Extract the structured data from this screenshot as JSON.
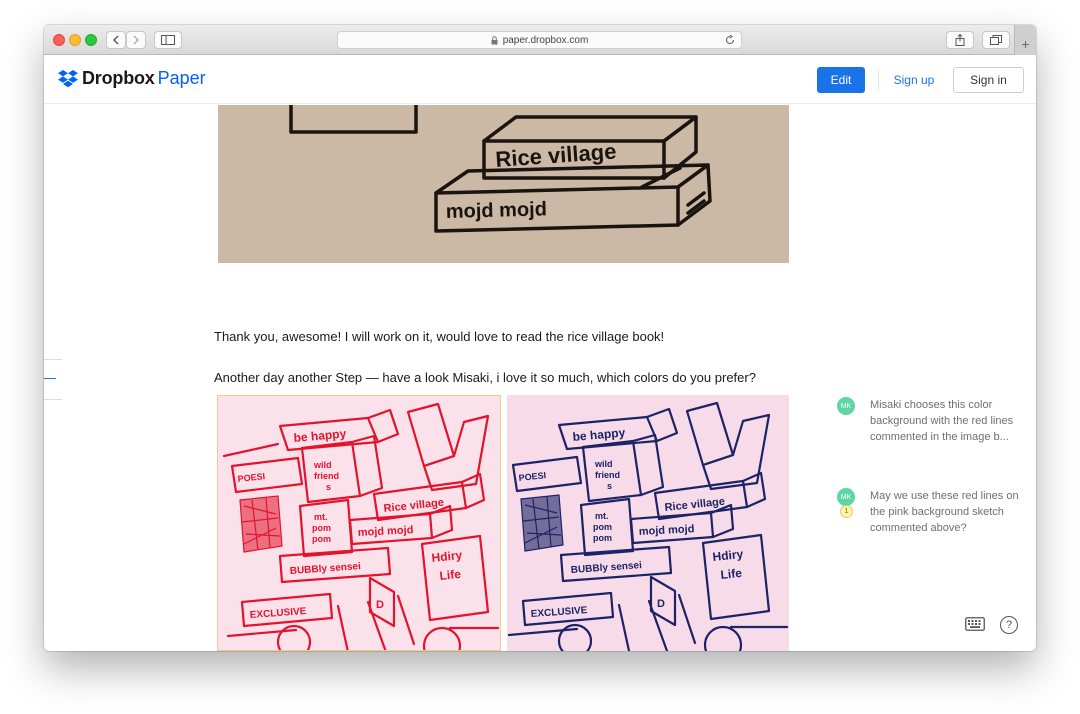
{
  "browser": {
    "url": "paper.dropbox.com",
    "new_tab_label": "+"
  },
  "header": {
    "brand_word": "Dropbox",
    "brand_product": "Paper",
    "edit_label": "Edit",
    "signup_label": "Sign up",
    "signin_label": "Sign in"
  },
  "doc": {
    "paragraph_1": "Thank you, awesome! I will work on it, would love to read the rice village book!",
    "paragraph_2": "Another day another Step — have a look Misaki, i love it so much, which colors do you prefer?",
    "sketch_top": {
      "book_1": "Rice village",
      "book_2": "mojd mojd"
    },
    "sketch_books": {
      "be_happy": "be happy",
      "poesi": "POESI",
      "wild": "wild",
      "friends": "friend",
      "s": "s",
      "rice_village": "Rice village",
      "mt": "mt.",
      "pom": "pom",
      "pom2": "pom",
      "mojd": "mojd mojd",
      "bubbly": "BUBBly sensei",
      "hairy": "Hdiry",
      "life": "Life",
      "exclusive": "EXCLUSIVE",
      "d": "D"
    },
    "sketch_colors": {
      "red": "#e2132c",
      "navy": "#1c2366"
    }
  },
  "comments": [
    {
      "initials": "MK",
      "text": "Misaki chooses this color background with the red lines commented in the image b..."
    },
    {
      "initials": "MK",
      "badge": "1",
      "text": "May we use these red lines on the pink background sketch commented above?"
    }
  ],
  "footer": {
    "help_label": "?"
  },
  "colors": {
    "accent": "#1a73e8",
    "brand": "#0061fe",
    "avatar": "#5dd6a6"
  }
}
